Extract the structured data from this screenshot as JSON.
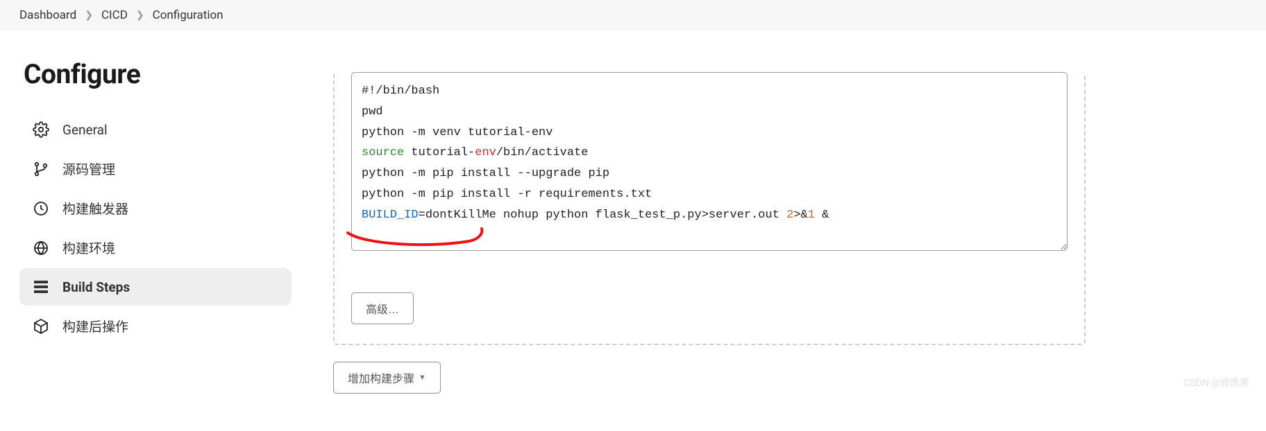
{
  "breadcrumb": {
    "items": [
      "Dashboard",
      "CICD",
      "Configuration"
    ]
  },
  "page": {
    "title": "Configure"
  },
  "sidebar": {
    "items": [
      {
        "label": "General",
        "icon": "gear-icon",
        "selected": false
      },
      {
        "label": "源码管理",
        "icon": "branch-icon",
        "selected": false
      },
      {
        "label": "构建触发器",
        "icon": "clock-icon",
        "selected": false
      },
      {
        "label": "构建环境",
        "icon": "globe-icon",
        "selected": false
      },
      {
        "label": "Build Steps",
        "icon": "steps-icon",
        "selected": true
      },
      {
        "label": "构建后操作",
        "icon": "box-icon",
        "selected": false
      }
    ]
  },
  "buildStep": {
    "code": {
      "line1": "#!/bin/bash",
      "line2": "pwd",
      "line3": "python -m venv tutorial-env",
      "line4_kw": "source",
      "line4_rest_a": " tutorial-",
      "line4_env": "env",
      "line4_rest_b": "/bin/activate",
      "line5": "python -m pip install --upgrade pip",
      "line6": "python -m pip install -r requirements.txt",
      "line7_var": "BUILD_ID",
      "line7_a": "=dontKillMe nohup python flask_test_p.py>server.out ",
      "line7_num": "2",
      "line7_b": ">&",
      "line7_num2": "1",
      "line7_c": " &"
    },
    "advancedLabel": "高级…"
  },
  "addStepLabel": "增加构建步骤",
  "watermark": "CSDN @修炼果"
}
